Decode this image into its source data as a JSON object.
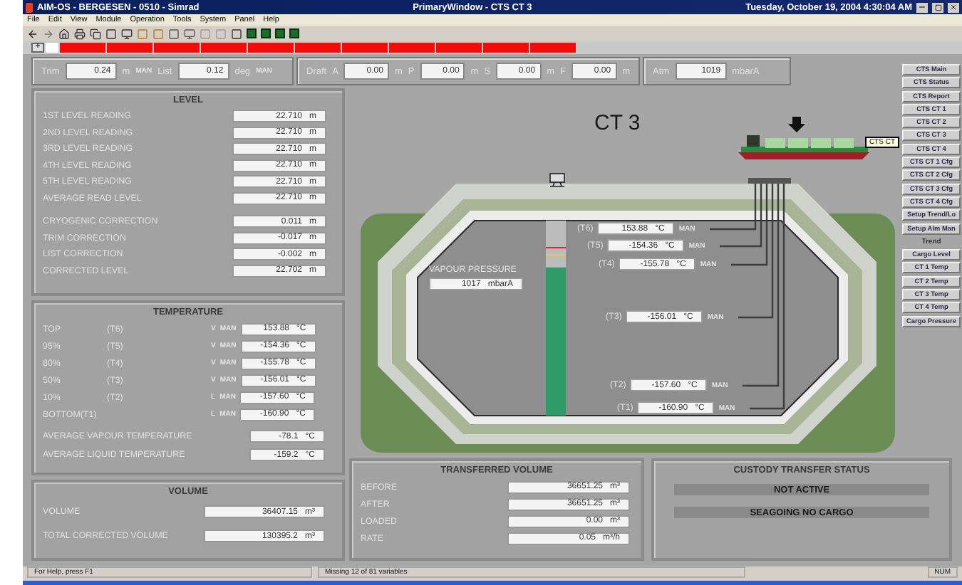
{
  "window": {
    "app_title": "AIM-OS - BERGESEN - 0510 - Simrad",
    "title": "PrimaryWindow - CTS CT 3",
    "datetime": "Tuesday, October 19, 2004 4:30:04 AM"
  },
  "menu": [
    "File",
    "Edit",
    "View",
    "Module",
    "Operation",
    "Tools",
    "System",
    "Panel",
    "Help"
  ],
  "alarm_bar": {
    "expand": "+"
  },
  "draft_bar": {
    "trim": {
      "label": "Trim",
      "value": "0.24",
      "unit": "m",
      "source": "MAN"
    },
    "list": {
      "label": "List",
      "value": "0.12",
      "unit": "deg",
      "source": "MAN"
    },
    "draft": {
      "label": "Draft",
      "marks": [
        {
          "label": "A",
          "value": "0.00",
          "unit": "m"
        },
        {
          "label": "P",
          "value": "0.00",
          "unit": "m"
        },
        {
          "label": "S",
          "value": "0.00",
          "unit": "m"
        },
        {
          "label": "F",
          "value": "0.00",
          "unit": "m"
        }
      ]
    },
    "atm": {
      "label": "Atm",
      "value": "1019",
      "unit": "mbarA"
    }
  },
  "level": {
    "title": "LEVEL",
    "readings": [
      {
        "label": "1ST LEVEL READING",
        "value": "22.710",
        "unit": "m"
      },
      {
        "label": "2ND LEVEL READING",
        "value": "22.710",
        "unit": "m"
      },
      {
        "label": "3RD LEVEL READING",
        "value": "22.710",
        "unit": "m"
      },
      {
        "label": "4TH LEVEL READING",
        "value": "22.710",
        "unit": "m"
      },
      {
        "label": "5TH LEVEL READING",
        "value": "22.710",
        "unit": "m"
      },
      {
        "label": "AVERAGE READ LEVEL",
        "value": "22.710",
        "unit": "m"
      }
    ],
    "corrections": [
      {
        "label": "CRYOGENIC CORRECTION",
        "value": "0.011",
        "unit": "m"
      },
      {
        "label": "TRIM CORRECTION",
        "value": "-0.017",
        "unit": "m"
      },
      {
        "label": "LIST CORRECTION",
        "value": "-0.002",
        "unit": "m"
      },
      {
        "label": "CORRECTED LEVEL",
        "value": "22.702",
        "unit": "m"
      }
    ]
  },
  "temperature": {
    "title": "TEMPERATURE",
    "rows": [
      {
        "label": "TOP",
        "sensor": "(T6)",
        "mode": "V",
        "source": "MAN",
        "value": "153.88",
        "unit": "°C"
      },
      {
        "label": "95%",
        "sensor": "(T5)",
        "mode": "V",
        "source": "MAN",
        "value": "-154.36",
        "unit": "°C"
      },
      {
        "label": "80%",
        "sensor": "(T4)",
        "mode": "V",
        "source": "MAN",
        "value": "-155.78",
        "unit": "°C"
      },
      {
        "label": "50%",
        "sensor": "(T3)",
        "mode": "V",
        "source": "MAN",
        "value": "-156.01",
        "unit": "°C"
      },
      {
        "label": "10%",
        "sensor": "(T2)",
        "mode": "L",
        "source": "MAN",
        "value": "-157.60",
        "unit": "°C"
      },
      {
        "label": "BOTTOM(T1)",
        "sensor": "",
        "mode": "L",
        "source": "MAN",
        "value": "-160.90",
        "unit": "°C"
      }
    ],
    "averages": [
      {
        "label": "AVERAGE VAPOUR TEMPERATURE",
        "value": "-78.1",
        "unit": "°C"
      },
      {
        "label": "AVERAGE LIQUID TEMPERATURE",
        "value": "-159.2",
        "unit": "°C"
      }
    ]
  },
  "volume": {
    "title": "VOLUME",
    "rows": [
      {
        "label": "VOLUME",
        "value": "36407.15",
        "unit": "m³"
      },
      {
        "label": "TOTAL CORRECTED VOLUME",
        "value": "130395.2",
        "unit": "m³"
      }
    ]
  },
  "tank": {
    "title": "CT 3",
    "gauge": {
      "level": 0.76
    },
    "vapour_pressure": {
      "label": "VAPOUR PRESSURE",
      "value": "1017",
      "unit": "mbarA"
    },
    "sensors": [
      {
        "sensor": "(T6)",
        "value": "153.88",
        "unit": "°C",
        "source": "MAN"
      },
      {
        "sensor": "(T5)",
        "value": "-154.36",
        "unit": "°C",
        "source": "MAN"
      },
      {
        "sensor": "(T4)",
        "value": "-155.78",
        "unit": "°C",
        "source": "MAN"
      },
      {
        "sensor": "(T3)",
        "value": "-156.01",
        "unit": "°C",
        "source": "MAN"
      },
      {
        "sensor": "(T2)",
        "value": "-157.60",
        "unit": "°C",
        "source": "MAN"
      },
      {
        "sensor": "(T1)",
        "value": "-160.90",
        "unit": "°C",
        "source": "MAN"
      }
    ]
  },
  "nav_buttons": [
    {
      "kind": "button",
      "label": "CTS Main"
    },
    {
      "kind": "button",
      "label": "CTS Status"
    },
    {
      "kind": "button",
      "label": "CTS Report"
    },
    {
      "kind": "button",
      "label": "CTS CT 1"
    },
    {
      "kind": "button",
      "label": "CTS CT 2"
    },
    {
      "kind": "button",
      "label": "CTS CT 3"
    },
    {
      "kind": "button",
      "label": "CTS CT 4"
    },
    {
      "kind": "button",
      "label": "CTS CT 1 Cfg"
    },
    {
      "kind": "button",
      "label": "CTS CT 2 Cfg"
    },
    {
      "kind": "button",
      "label": "CTS CT 3 Cfg"
    },
    {
      "kind": "button",
      "label": "CTS CT 4 Cfg"
    },
    {
      "kind": "button",
      "label": "Setup Trend/Lo"
    },
    {
      "kind": "button",
      "label": "Setup Alm Man"
    },
    {
      "kind": "heading",
      "label": "Trend"
    },
    {
      "kind": "button",
      "label": "Cargo Level"
    },
    {
      "kind": "button",
      "label": "CT 1 Temp"
    },
    {
      "kind": "button",
      "label": "CT 2 Temp"
    },
    {
      "kind": "button",
      "label": "CT 3 Temp"
    },
    {
      "kind": "button",
      "label": "CT 4 Temp"
    },
    {
      "kind": "button",
      "label": "Cargo Pressure"
    }
  ],
  "tooltip": "CTS CT",
  "transferred_volume": {
    "title": "TRANSFERRED VOLUME",
    "rows": [
      {
        "label": "BEFORE",
        "value": "36651.25",
        "unit": "m³"
      },
      {
        "label": "AFTER",
        "value": "36651.25",
        "unit": "m³"
      },
      {
        "label": "LOADED",
        "value": "0.00",
        "unit": "m³"
      },
      {
        "label": "RATE",
        "value": "0.05",
        "unit": "m³/h"
      }
    ]
  },
  "custody_transfer": {
    "title": "CUSTODY TRANSFER STATUS",
    "statuses": [
      "NOT ACTIVE",
      "SEAGOING NO CARGO"
    ]
  },
  "status_bar": {
    "help": "For Help, press F1",
    "message": "Missing 12 of 81 variables",
    "indicator": "NUM"
  }
}
